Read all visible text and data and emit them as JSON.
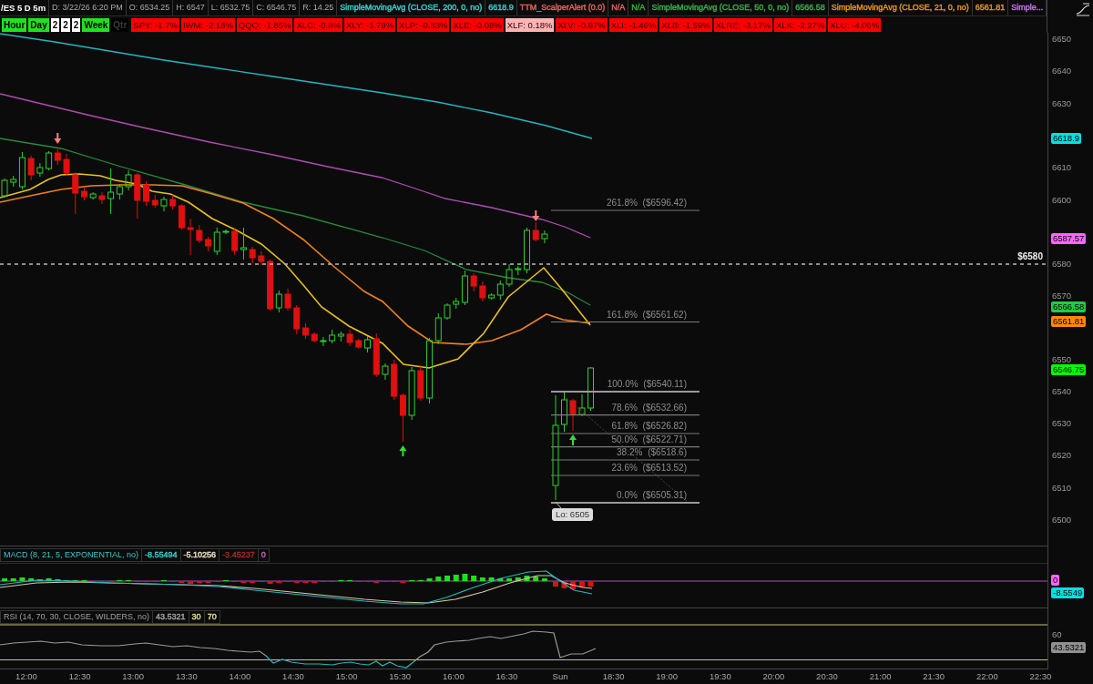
{
  "header": {
    "symbol": "/ES 5 D 5m",
    "fields": [
      "D: 3/22/26 6:20 PM",
      "O: 6534.25",
      "H: 6547",
      "L: 6532.75",
      "C: 6546.75",
      "R: 14.25"
    ],
    "studies": [
      {
        "text": "SimpleMovingAvg (CLOSE, 200, 0, no)",
        "color": "#3cc8c8"
      },
      {
        "text": "6618.9",
        "color": "#3cc8c8"
      },
      {
        "text": "TTM_ScalperAlert (0.0)",
        "color": "#e0605a"
      },
      {
        "text": "N/A",
        "color": "#e0605a"
      },
      {
        "text": "N/A",
        "color": "#3aaa3a"
      },
      {
        "text": "SimpleMovingAvg (CLOSE, 50, 0, no)",
        "color": "#3aaa4a"
      },
      {
        "text": "6566.58",
        "color": "#3aaa4a"
      },
      {
        "text": "SimpleMovingAvg (CLOSE, 21, 0, no)",
        "color": "#e0902a"
      },
      {
        "text": "6561.81",
        "color": "#e0902a"
      },
      {
        "text": "Simple...",
        "color": "#c070e0"
      }
    ]
  },
  "period_buttons": [
    {
      "label": "Hour",
      "color": "#22e022"
    },
    {
      "label": "Day",
      "color": "#22e022"
    },
    {
      "label": "2",
      "color": "#ffffff"
    },
    {
      "label": "2",
      "color": "#ffffff"
    },
    {
      "label": "2",
      "color": "#ffffff"
    },
    {
      "label": "Week",
      "color": "#22e022"
    },
    {
      "label": "Qtr",
      "color": "#000000"
    }
  ],
  "tickers": [
    {
      "label": "SPY: -1.7%",
      "color": "#ff0000"
    },
    {
      "label": "IWM: -2.18%",
      "color": "#ff0000"
    },
    {
      "label": "QQQ: -1.85%",
      "color": "#ff0000"
    },
    {
      "label": "XLC: -0.8%",
      "color": "#ff0000"
    },
    {
      "label": "XLY: -1.79%",
      "color": "#ff0000"
    },
    {
      "label": "XLP: -0.83%",
      "color": "#ff0000"
    },
    {
      "label": "XLE: -0.08%",
      "color": "#ff0000"
    },
    {
      "label": "XLF: 0.18%",
      "color": "#ffb4b4"
    },
    {
      "label": "XLV: -0.87%",
      "color": "#ff0000"
    },
    {
      "label": "XLI: -1.46%",
      "color": "#ff0000"
    },
    {
      "label": "XLB: -1.59%",
      "color": "#ff0000"
    },
    {
      "label": "XLRE: -3.17%",
      "color": "#ff0000"
    },
    {
      "label": "XLK: -2.27%",
      "color": "#ff0000"
    },
    {
      "label": "XLU: -4.06%",
      "color": "#ff0000"
    }
  ],
  "price_chart": {
    "axis_labels": [
      "6650",
      "6640",
      "6630",
      "6610",
      "6600",
      "6580",
      "6570",
      "6550",
      "6540",
      "6530",
      "6520",
      "6510",
      "6500"
    ],
    "price_tags": [
      {
        "text": "6618.9",
        "color": "#00e0e0"
      },
      {
        "text": "6587.57",
        "color": "#ff66ff"
      },
      {
        "text": "6566.58",
        "color": "#22cc44"
      },
      {
        "text": "6561.81",
        "color": "#ff8800"
      },
      {
        "text": "6546.75",
        "color": "#00ff00"
      }
    ],
    "price_level": "$6580",
    "fib_levels": [
      "261.8% ($6596.42)",
      "161.8% ($6561.62)",
      "100.0% ($6540.11)",
      "78.6% ($6532.66)",
      "61.8% ($6526.82)",
      "50.0% ($6522.71)",
      "38.2% ($6518.6)",
      "23.6% ($6513.52)",
      "0.0% ($6505.31)"
    ],
    "low_label": "Lo: 6505"
  },
  "macd": {
    "title": "MACD (8, 21, 5, EXPONENTIAL, no)",
    "values": [
      {
        "text": "-8.55494",
        "color": "#3cc8c8"
      },
      {
        "text": "-5.10256",
        "color": "#e8dcc0"
      },
      {
        "text": "-3.45237",
        "color": "#a02828"
      },
      {
        "text": "0",
        "color": "#c060c0"
      }
    ],
    "tags": [
      {
        "text": "0",
        "color": "#ff66ff"
      },
      {
        "text": "-8.5549",
        "color": "#00e0e0"
      }
    ]
  },
  "rsi": {
    "title": "RSI (14, 70, 30, CLOSE, WILDERS, no)",
    "values": [
      {
        "text": "43.5321",
        "color": "#a0a0a0"
      },
      {
        "text": "30",
        "color": "#e0d890"
      },
      {
        "text": "70",
        "color": "#e0d890"
      }
    ],
    "axis_labels": [
      "60"
    ],
    "tag": {
      "text": "43.5321",
      "color": "#909090"
    }
  },
  "time_axis": [
    "12:00",
    "12:30",
    "13:00",
    "13:30",
    "14:00",
    "14:30",
    "15:00",
    "15:30",
    "16:00",
    "16:30",
    "Sun",
    "18:30",
    "19:00",
    "19:30",
    "20:00",
    "20:30",
    "21:00",
    "21:30",
    "22:00",
    "22:30"
  ]
}
